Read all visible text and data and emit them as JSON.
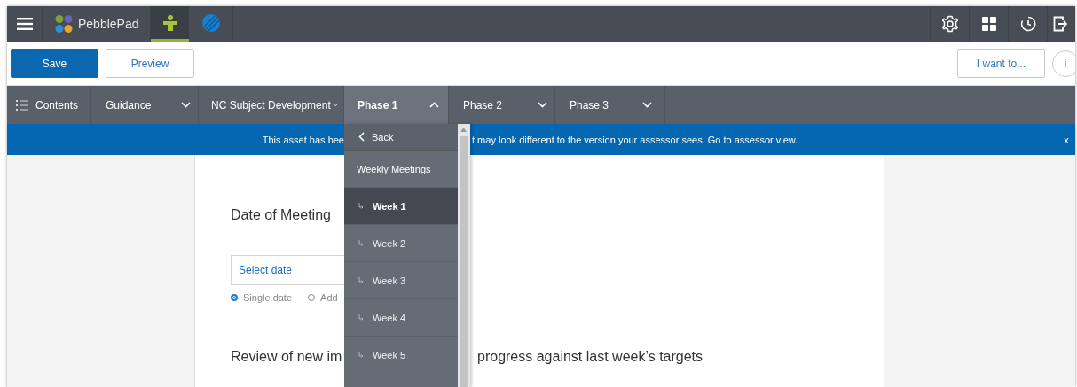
{
  "top_bar": {
    "brand": "PebblePad",
    "tabs": [
      {
        "kind": "person",
        "selected": true
      },
      {
        "kind": "globe",
        "selected": false
      }
    ]
  },
  "toolbar": {
    "save": "Save",
    "preview": "Preview",
    "i_want_to": "I want to...",
    "info": "i"
  },
  "nav": [
    {
      "label": "Contents",
      "kind": "contents",
      "expanded": false
    },
    {
      "label": "Guidance",
      "kind": "menu",
      "expanded": false
    },
    {
      "label": "NC Subject Development",
      "kind": "menu",
      "expanded": false
    },
    {
      "label": "Phase 1",
      "kind": "menu",
      "expanded": true
    },
    {
      "label": "Phase 2",
      "kind": "menu",
      "expanded": false
    },
    {
      "label": "Phase 3",
      "kind": "menu",
      "expanded": false
    }
  ],
  "banner": {
    "text_left": "This asset has bee",
    "text_right": "t may look different to the version your assessor sees. Go to assessor view.",
    "close": "x"
  },
  "dropdown": {
    "back": "Back",
    "heading": "Weekly Meetings",
    "items": [
      {
        "label": "Week 1",
        "selected": true
      },
      {
        "label": "Week 2",
        "selected": false
      },
      {
        "label": "Week 3",
        "selected": false
      },
      {
        "label": "Week 4",
        "selected": false
      },
      {
        "label": "Week 5",
        "selected": false
      }
    ]
  },
  "content": {
    "date_label": "Date of Meeting",
    "date_field": "Select date",
    "options": [
      {
        "label": "Single date",
        "selected": true
      },
      {
        "label": "Add",
        "selected": false
      }
    ],
    "review_left": "Review of new im",
    "review_right": "progress against last week’s targets"
  }
}
